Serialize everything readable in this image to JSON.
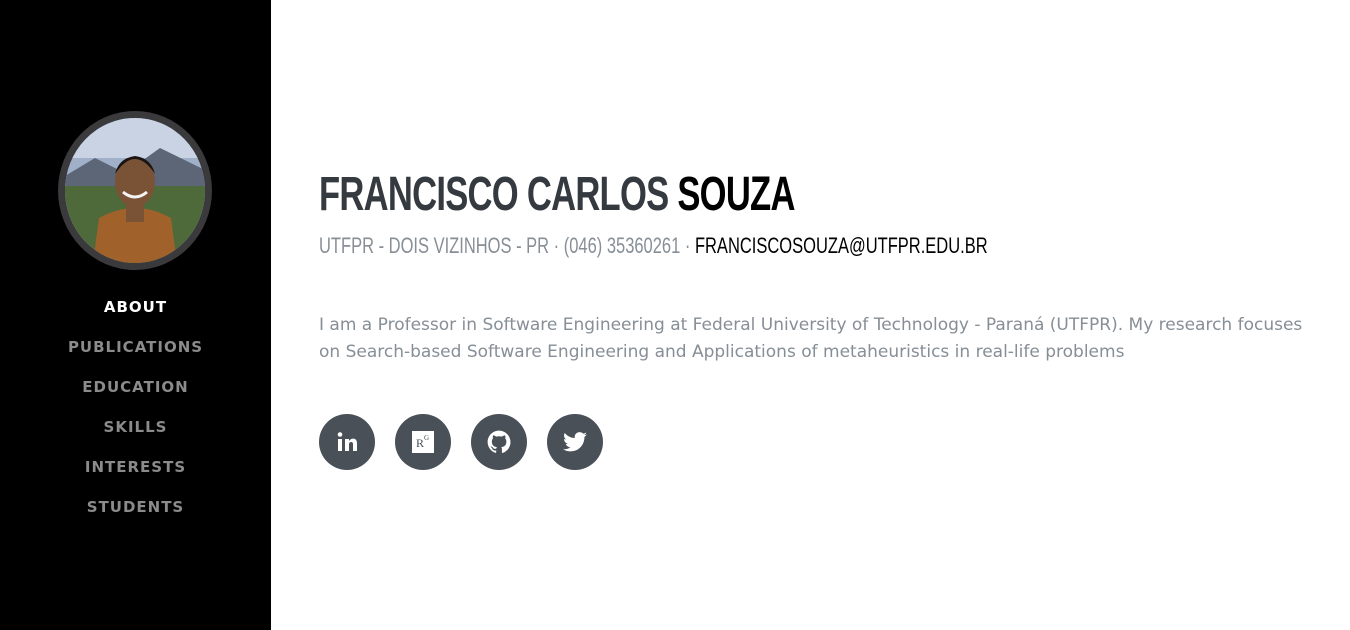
{
  "sidebar": {
    "nav": [
      {
        "label": "About",
        "active": true
      },
      {
        "label": "Publications"
      },
      {
        "label": "Education"
      },
      {
        "label": "Skills"
      },
      {
        "label": "Interests"
      },
      {
        "label": "Students"
      }
    ]
  },
  "profile": {
    "first_name": "Francisco Carlos",
    "last_name": "Souza",
    "contact": "UTFPR - Dois Vizinhos - PR · (046) 35360261 · ",
    "email": "franciscosouza@utfpr.edu.br",
    "bio": "I am a Professor in Software Engineering at Federal University of Technology - Paraná (UTFPR). My research focuses on Search-based Software Engineering and Applications of metaheuristics in real-life problems"
  },
  "social": [
    {
      "icon": "linkedin-icon"
    },
    {
      "icon": "researchgate-icon"
    },
    {
      "icon": "github-icon"
    },
    {
      "icon": "twitter-icon"
    }
  ],
  "colors": {
    "sidebar_bg": "#000000",
    "nav_active": "#ffffff",
    "nav_inactive": "#8b8b8b",
    "heading": "#343a40",
    "muted": "#868e96",
    "social_bg": "#495057"
  }
}
